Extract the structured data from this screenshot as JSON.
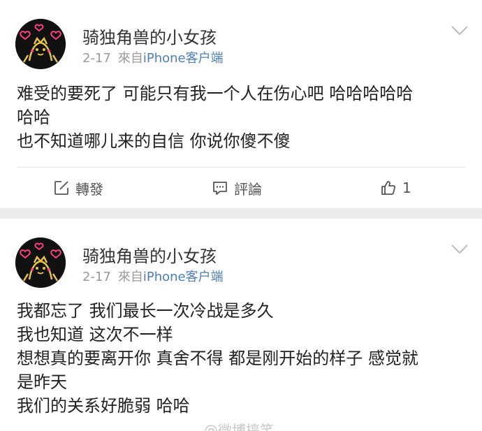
{
  "posts": [
    {
      "username": "骑独角兽的小女孩",
      "date": "2-17",
      "source_prefix": "來自",
      "source_device": "iPhone客户端",
      "lines": [
        "难受的要死了 可能只有我一个人在伤心吧 哈哈哈哈哈",
        "哈哈",
        "也不知道哪儿来的自信 你说你傻不傻"
      ],
      "actions": {
        "repost_label": "轉發",
        "repost_icon": "edit-square-icon",
        "comment_label": "評論",
        "comment_icon": "speech-bubble-icon",
        "like_count": "1",
        "like_icon": "thumbs-up-icon"
      }
    },
    {
      "username": "骑独角兽的小女孩",
      "date": "2-17",
      "source_prefix": "來自",
      "source_device": "iPhone客户端",
      "lines": [
        "我都忘了 我们最长一次冷战是多久",
        "我也知道 这次不一样",
        "想想真的要离开你 真舍不得 都是刚开始的样子 感觉就",
        "是昨天",
        "我们的关系好脆弱  哈哈"
      ]
    }
  ],
  "watermark": "@微博搞笑",
  "colors": {
    "link_blue": "#4d7fb7",
    "meta_gray": "#999999",
    "background_gap": "#ececec",
    "heart_pink": "#ff3f7f",
    "avatar_gold": "#e8c34a"
  }
}
